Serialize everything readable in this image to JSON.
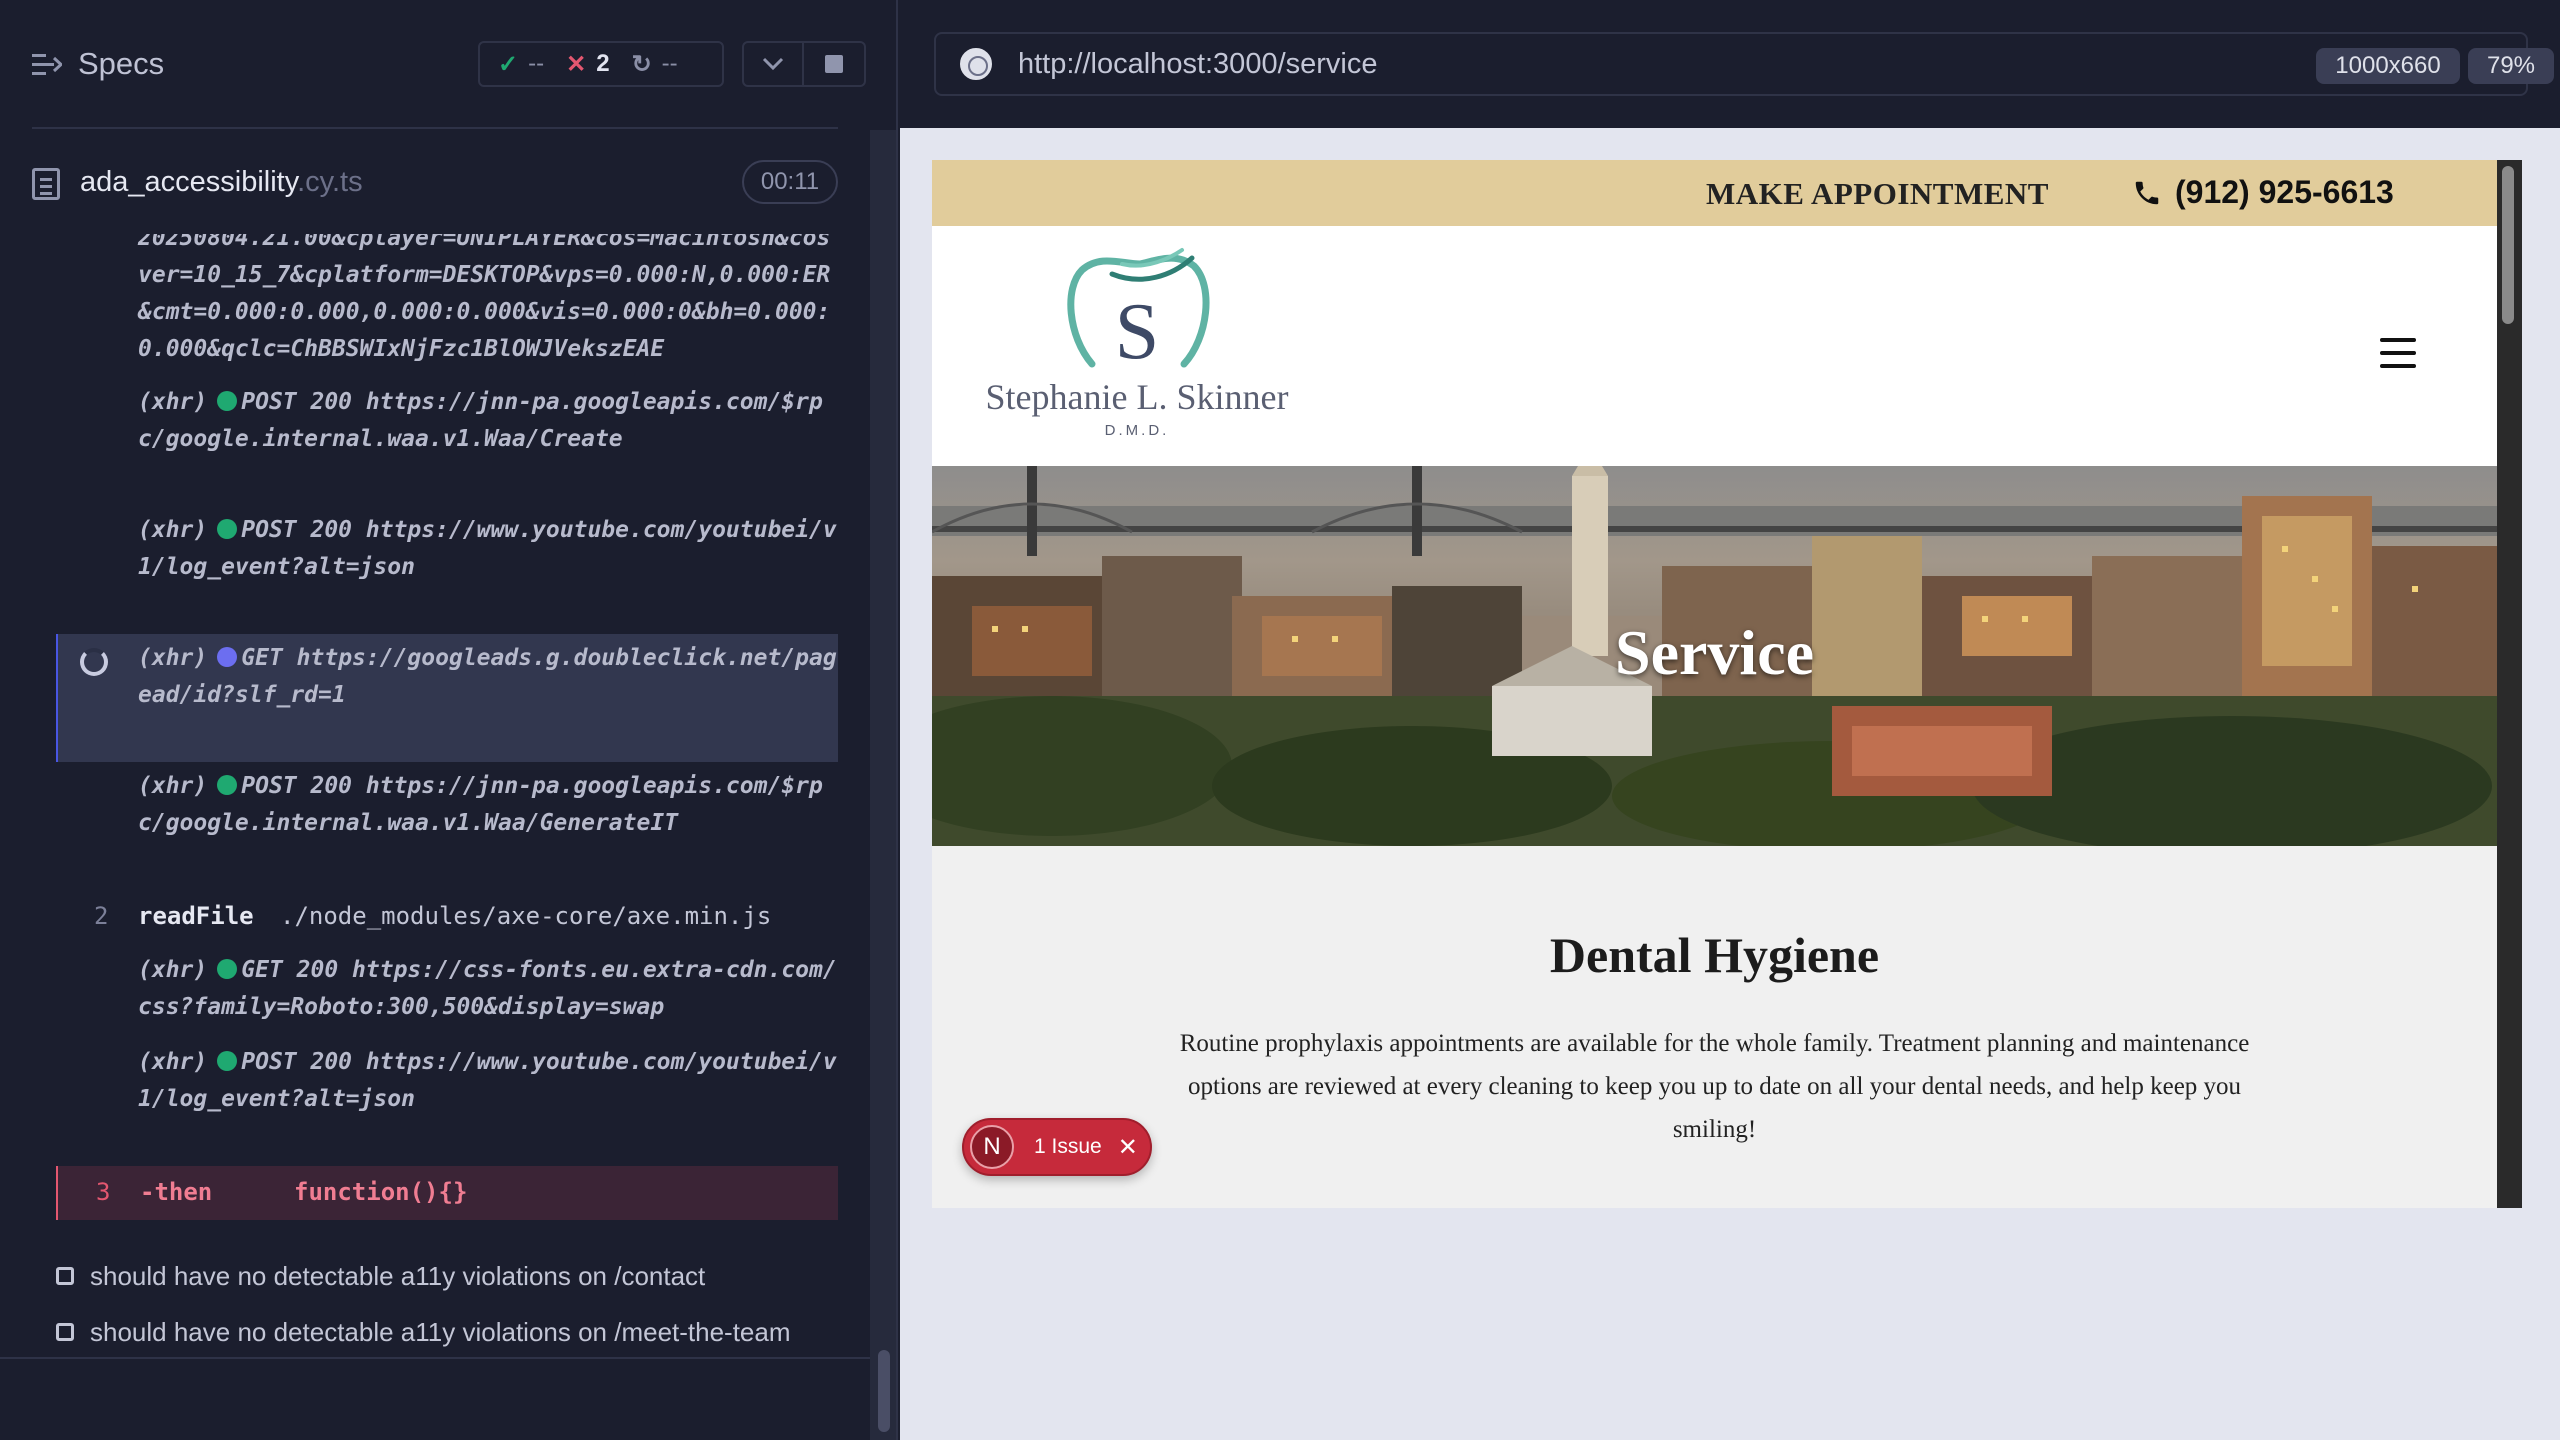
{
  "runner": {
    "specs_title": "Specs",
    "stats": {
      "passed": "--",
      "failed": "2",
      "pending": "--"
    },
    "spec_file": {
      "name": "ada_accessibility",
      "ext": ".cy.ts",
      "duration": "00:11"
    }
  },
  "log": {
    "entries": [
      {
        "kind": "text",
        "text": "20250804.21.00&cplayer=UNIPLAYER&cos=Macintosh&cosver=10_15_7&cplatform=DESKTOP&vps=0.000:N,0.000:ER&cmt=0.000:0.000,0.000:0.000&vis=0.000:0&bh=0.000:0.000&qclc=ChBBSWIxNjFzc1BlOWJVekszEAE"
      },
      {
        "kind": "xhr",
        "prefix": "(xhr)",
        "status": "POST 200",
        "url": "https://jnn-pa.googleapis.com/$rpc/google.internal.waa.v1.Waa/Create"
      },
      {
        "kind": "xhr",
        "prefix": "(xhr)",
        "status": "POST 200",
        "url": "https://www.youtube.com/youtubei/v1/log_event?alt=json"
      },
      {
        "kind": "xhr-active",
        "prefix": "(xhr)",
        "status": "GET",
        "url": "https://googleads.g.doubleclick.net/pagead/id?slf_rd=1"
      },
      {
        "kind": "xhr",
        "prefix": "(xhr)",
        "status": "POST 200",
        "url": "https://jnn-pa.googleapis.com/$rpc/google.internal.waa.v1.Waa/GenerateIT"
      },
      {
        "kind": "cmd",
        "num": "2",
        "name": "readFile",
        "arg": "./node_modules/axe-core/axe.min.js"
      },
      {
        "kind": "xhr",
        "prefix": "(xhr)",
        "status": "GET 200",
        "url": "https://css-fonts.eu.extra-cdn.com/css?family=Roboto:300,500&display=swap"
      },
      {
        "kind": "xhr",
        "prefix": "(xhr)",
        "status": "POST 200",
        "url": "https://www.youtube.com/youtubei/v1/log_event?alt=json"
      },
      {
        "kind": "fail",
        "num": "3",
        "name": "-then",
        "arg": "function(){}"
      }
    ],
    "tests": [
      "should have no detectable a11y violations on /contact",
      "should have no detectable a11y violations on /meet-the-team"
    ]
  },
  "browser": {
    "url": "http://localhost:3000/service",
    "viewport": "1000x660",
    "zoom": "79%"
  },
  "site": {
    "make_appointment": "MAKE APPOINTMENT",
    "phone": "(912) 925-6613",
    "logo_letter": "S",
    "logo_name": "Stephanie L. Skinner",
    "logo_suffix": "D.M.D.",
    "hero_title": "Service",
    "section_title": "Dental Hygiene",
    "section_text": "Routine prophylaxis appointments are available for the whole family. Treatment planning and maintenance options are reviewed at every cleaning to keep you up to date on all your dental needs, and help keep you smiling!"
  },
  "issue_badge": {
    "letter": "N",
    "label": "1 Issue"
  },
  "colors": {
    "runner_bg": "#1b1e2e",
    "pass": "#1fa971",
    "fail": "#e45770",
    "active": "#4956e3",
    "top_band": "#e1cc9b",
    "issue": "#c62a3b"
  }
}
